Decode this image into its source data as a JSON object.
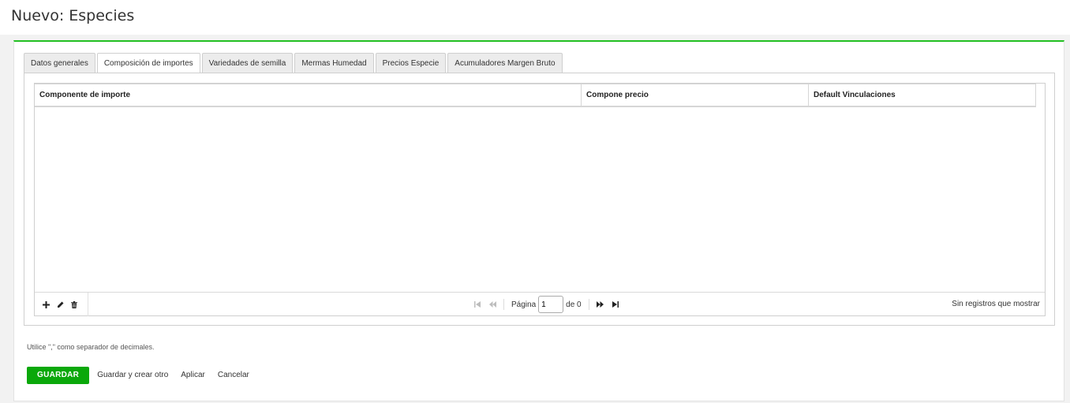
{
  "page": {
    "title": "Nuevo: Especies"
  },
  "colors": {
    "accent": "#22c022",
    "primary_button": "#0aa80a"
  },
  "tabs": [
    {
      "label": "Datos generales",
      "active": false
    },
    {
      "label": "Composición de importes",
      "active": true
    },
    {
      "label": "Variedades de semilla",
      "active": false
    },
    {
      "label": "Mermas Humedad",
      "active": false
    },
    {
      "label": "Precios Especie",
      "active": false
    },
    {
      "label": "Acumuladores Margen Bruto",
      "active": false
    }
  ],
  "grid": {
    "columns": [
      "Componente de importe",
      "Compone precio",
      "Default Vinculaciones"
    ],
    "rows": []
  },
  "pager": {
    "tools": [
      "plus-icon",
      "pencil-icon",
      "trash-icon"
    ],
    "page_label": "Página",
    "page_value": "1",
    "of_label": "de 0",
    "status": "Sin registros que mostrar"
  },
  "footer": {
    "hint": "Utilice \",\" como separador de decimales.",
    "save_label": "GUARDAR",
    "save_and_new_label": "Guardar y crear otro",
    "apply_label": "Aplicar",
    "cancel_label": "Cancelar"
  }
}
